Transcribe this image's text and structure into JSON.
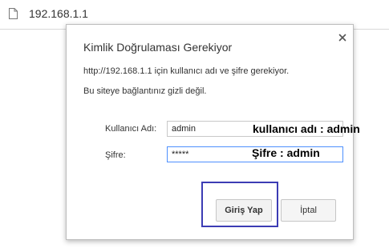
{
  "browser": {
    "url": "192.168.1.1",
    "page_icon": "page-icon"
  },
  "dialog": {
    "title": "Kimlik Doğrulaması Gerekiyor",
    "close_icon": "close-icon",
    "message_line1": "http://192.168.1.1 için kullanıcı adı ve şifre gerekiyor.",
    "message_line2": "Bu siteye bağlantınız gizli değil.",
    "username_label": "Kullanıcı Adı:",
    "username_value": "admin",
    "password_label": "Şifre:",
    "password_value": "*****",
    "login_button": "Giriş Yap",
    "cancel_button": "İptal"
  },
  "annotations": {
    "username_note": "kullanıcı adı : admin",
    "password_note": "Şifre : admin",
    "highlight_color": "#3c3cb4"
  }
}
